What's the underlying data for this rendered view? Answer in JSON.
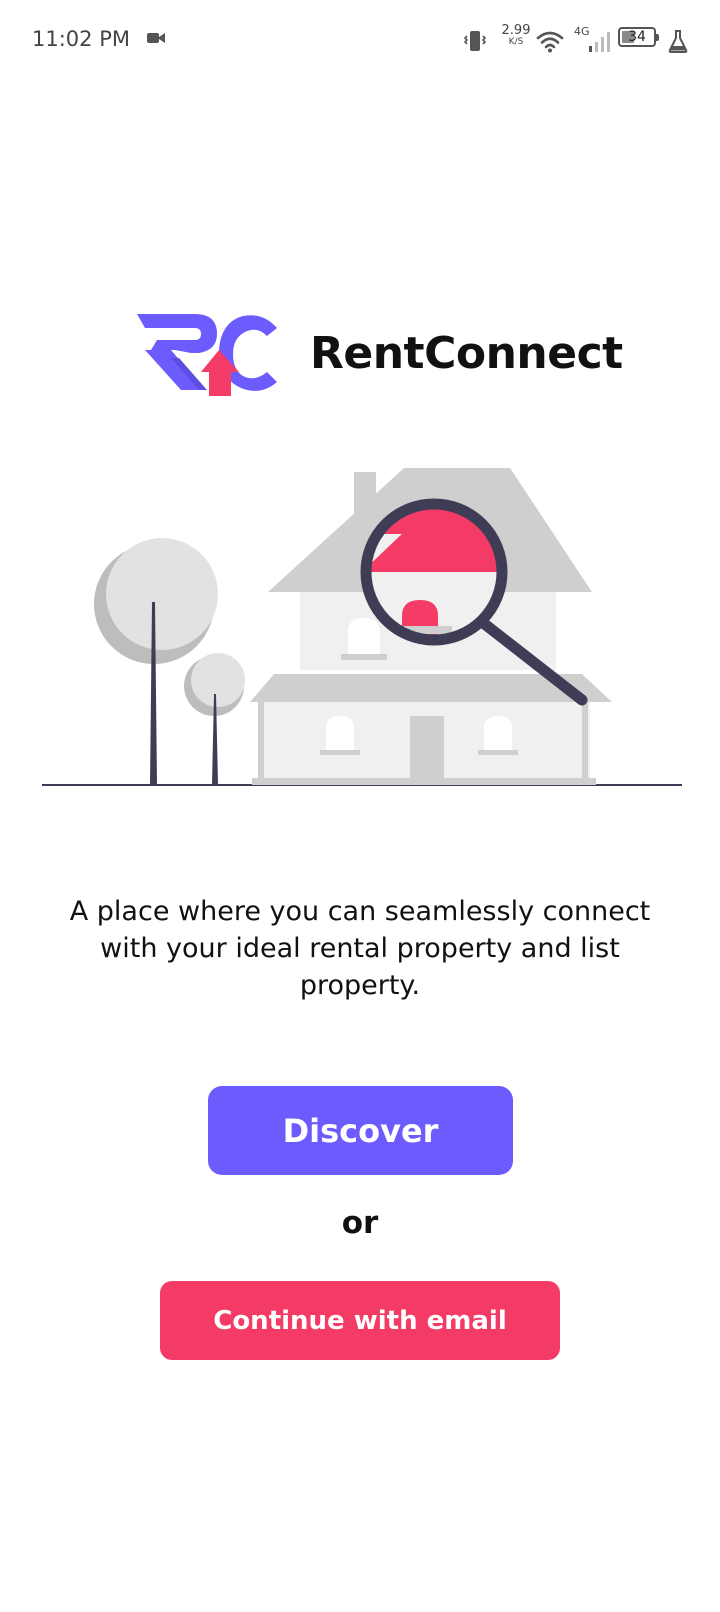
{
  "status_bar": {
    "time": "11:02 PM",
    "net_speed_value": "2.99",
    "net_speed_unit": "K/S",
    "network_type": "4G",
    "battery_level": "34",
    "icons": [
      "video-camera-icon",
      "vibrate-icon",
      "wifi-icon",
      "signal-icon",
      "battery-icon",
      "lab-flask-icon"
    ]
  },
  "brand": {
    "name": "RentConnect",
    "logo_colors": {
      "primary": "#6c5cfd",
      "accent": "#f33b66"
    }
  },
  "illustration": {
    "subject": "house-search-illustration",
    "colors": {
      "house": "#d9d9d9",
      "lens": "#f33b66",
      "handle": "#3f3d56"
    }
  },
  "tagline": "A place where you can seamlessly connect with your ideal rental property and list property.",
  "actions": {
    "discover_label": "Discover",
    "or_label": "or",
    "email_label": "Continue with email",
    "discover_color": "#6c5cfd",
    "email_color": "#f33b66"
  }
}
